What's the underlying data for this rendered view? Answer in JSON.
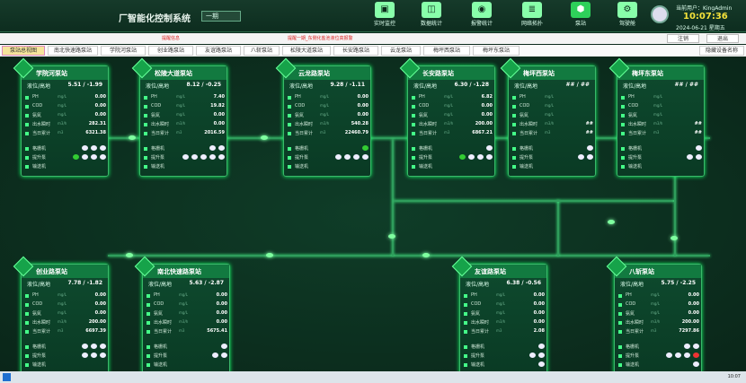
{
  "header": {
    "title": "厂智能化控制系统",
    "period": "一期",
    "nav": [
      {
        "label": "实时监控",
        "icon": "monitor-icon"
      },
      {
        "label": "数据统计",
        "icon": "database-icon"
      },
      {
        "label": "报警统计",
        "icon": "alarm-icon"
      },
      {
        "label": "网络拓扑",
        "icon": "network-icon"
      },
      {
        "label": "泵站",
        "icon": "pump-icon"
      },
      {
        "label": "驾驶舱",
        "icon": "cockpit-icon"
      }
    ],
    "user_label": "当前用户：",
    "user": "KingAdmin",
    "time": "10:07:36",
    "date": "2024-06-21",
    "weekday": "星期五"
  },
  "alerts": [
    "提醒信息",
    "提醒一期_东侧化盐池液位高报警"
  ],
  "buttons": {
    "cancel": "注销",
    "exit": "退出"
  },
  "tabs": [
    "泵站总视图",
    "南北快速路泵站",
    "学院河泵站",
    "创业路泵站",
    "友谊路泵站",
    "八斩泵站",
    "松陵大道泵站",
    "长安路泵站",
    "云龙泵站",
    "梅坪西泵站",
    "梅坪东泵站",
    "隐藏设备名称"
  ],
  "labels": {
    "level": "液位/高地",
    "ph": "PH",
    "cod": "COD",
    "nh": "氨氮",
    "flow": "出水瞬时",
    "total": "当日累计",
    "grid": "格栅机",
    "pump": "提升泵",
    "conv": "输送机",
    "mgl": "mg/L",
    "m3h": "m3/h",
    "m3": "m3"
  },
  "stations": [
    {
      "name": "学院河泵站",
      "level": "5.51 / -1.99",
      "ph": "0.00",
      "cod": "0.00",
      "nh": "0.00",
      "flow": "282.31",
      "total": "6321.38",
      "grid": [
        "w",
        "w",
        "w"
      ],
      "pump": [
        "g",
        "w",
        "w",
        "w"
      ],
      "conv": []
    },
    {
      "name": "松陵大道泵站",
      "level": "8.12 / -0.25",
      "ph": "7.40",
      "cod": "19.82",
      "nh": "0.00",
      "flow": "0.00",
      "total": "2016.59",
      "grid": [
        "w",
        "w"
      ],
      "pump": [
        "w",
        "w",
        "w",
        "w",
        "w"
      ],
      "conv": []
    },
    {
      "name": "云龙路泵站",
      "level": "9.28 / -1.11",
      "ph": "0.00",
      "cod": "0.00",
      "nh": "0.00",
      "flow": "540.28",
      "total": "22460.79",
      "grid": [
        "g"
      ],
      "pump": [
        "w",
        "w",
        "w",
        "w"
      ],
      "conv": []
    },
    {
      "name": "长安路泵站",
      "level": "6.30 / -1.28",
      "ph": "6.82",
      "cod": "0.00",
      "nh": "0.00",
      "flow": "200.00",
      "total": "6867.21",
      "grid": [
        "w"
      ],
      "pump": [
        "g",
        "w",
        "w",
        "w"
      ],
      "conv": []
    },
    {
      "name": "梅坪西泵站",
      "level": "## / ##",
      "ph": "",
      "cod": "",
      "nh": "",
      "flow": "##",
      "total": "##",
      "grid": [
        "w"
      ],
      "pump": [
        "w",
        "w"
      ],
      "conv": []
    },
    {
      "name": "梅坪东泵站",
      "level": "## / ##",
      "ph": "",
      "cod": "",
      "nh": "",
      "flow": "##",
      "total": "##",
      "grid": [
        "w"
      ],
      "pump": [
        "w",
        "w"
      ],
      "conv": []
    },
    {
      "name": "创业路泵站",
      "level": "7.78 / -1.82",
      "ph": "0.00",
      "cod": "0.00",
      "nh": "0.00",
      "flow": "200.00",
      "total": "6697.39",
      "grid": [
        "w",
        "w",
        "w"
      ],
      "pump": [
        "w",
        "w",
        "w"
      ],
      "conv": []
    },
    {
      "name": "南北快速路泵站",
      "level": "5.63 / -2.87",
      "ph": "0.00",
      "cod": "0.00",
      "nh": "0.00",
      "flow": "0.00",
      "total": "5675.41",
      "grid": [
        "w"
      ],
      "pump": [
        "w",
        "w"
      ],
      "conv": []
    },
    {
      "name": "友谊路泵站",
      "level": "6.38 / -0.56",
      "ph": "0.00",
      "cod": "0.00",
      "nh": "0.00",
      "flow": "0.00",
      "total": "2.08",
      "grid": [
        "w"
      ],
      "pump": [
        "w",
        "w"
      ],
      "conv": [
        "w"
      ]
    },
    {
      "name": "八斩泵站",
      "level": "5.75 / -2.25",
      "ph": "0.00",
      "cod": "0.00",
      "nh": "0.00",
      "flow": "200.00",
      "total": "7297.86",
      "grid": [
        "w",
        "w"
      ],
      "pump": [
        "w",
        "w",
        "w",
        "r"
      ],
      "conv": [
        "w"
      ]
    }
  ],
  "taskbar": {
    "clock": "10:07"
  }
}
